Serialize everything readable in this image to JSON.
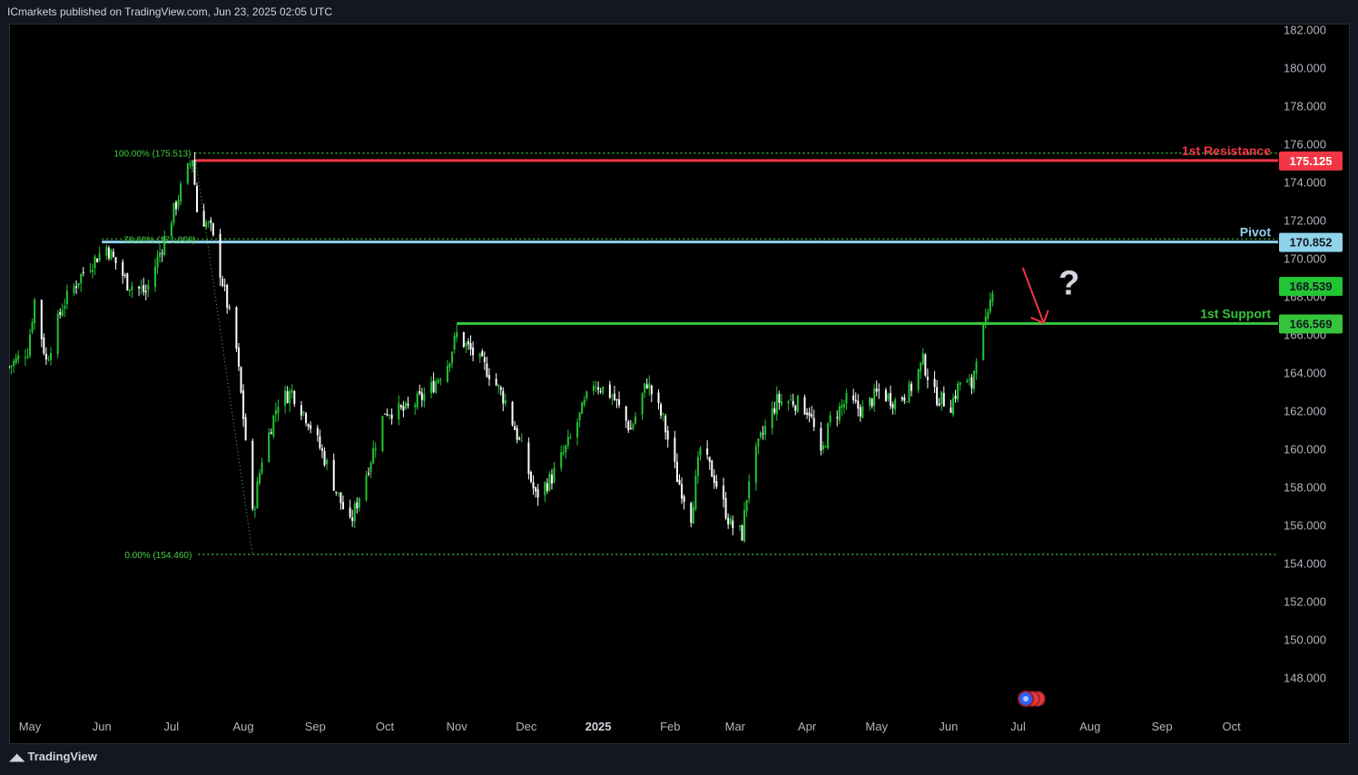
{
  "header": {
    "text": "ICmarkets published on TradingView.com, Jun 23, 2025 02:05 UTC"
  },
  "footer": {
    "brand": "TradingView",
    "logo_icon": "tradingview-logo-icon"
  },
  "colors": {
    "background": "#000000",
    "up": "#22c533",
    "down": "#ffffff",
    "resistance": "#f23645",
    "pivot": "#8fd3ea",
    "support": "#35c43b",
    "fib": "#44d044",
    "arrow": "#f23645"
  },
  "chart_data": {
    "type": "candlestick",
    "symbol": "",
    "y_axis": {
      "min": 146.0,
      "max": 183.0,
      "ticks": [
        "182.000",
        "180.000",
        "178.000",
        "176.000",
        "174.000",
        "172.000",
        "170.000",
        "168.000",
        "166.000",
        "164.000",
        "162.000",
        "160.000",
        "158.000",
        "156.000",
        "154.000",
        "152.000",
        "150.000",
        "148.000"
      ]
    },
    "x_axis": {
      "start_date": "2024-04-22",
      "end_date": "2025-10-16",
      "labels": [
        {
          "date": "2024-05-01",
          "text": "May"
        },
        {
          "date": "2024-06-01",
          "text": "Jun"
        },
        {
          "date": "2024-07-01",
          "text": "Jul"
        },
        {
          "date": "2024-08-01",
          "text": "Aug"
        },
        {
          "date": "2024-09-01",
          "text": "Sep"
        },
        {
          "date": "2024-10-01",
          "text": "Oct"
        },
        {
          "date": "2024-11-01",
          "text": "Nov"
        },
        {
          "date": "2024-12-01",
          "text": "Dec"
        },
        {
          "date": "2025-01-01",
          "text": "2025",
          "bold": true
        },
        {
          "date": "2025-02-01",
          "text": "Feb"
        },
        {
          "date": "2025-03-01",
          "text": "Mar"
        },
        {
          "date": "2025-04-01",
          "text": "Apr"
        },
        {
          "date": "2025-05-01",
          "text": "May"
        },
        {
          "date": "2025-06-01",
          "text": "Jun"
        },
        {
          "date": "2025-07-01",
          "text": "Jul"
        },
        {
          "date": "2025-08-01",
          "text": "Aug"
        },
        {
          "date": "2025-09-01",
          "text": "Sep"
        },
        {
          "date": "2025-10-01",
          "text": "Oct"
        }
      ]
    },
    "price_path": [
      {
        "date": "2024-04-22",
        "price": 164.3
      },
      {
        "date": "2024-04-30",
        "price": 165.2
      },
      {
        "date": "2024-05-03",
        "price": 167.8
      },
      {
        "date": "2024-05-08",
        "price": 164.6
      },
      {
        "date": "2024-05-15",
        "price": 167.5
      },
      {
        "date": "2024-05-24",
        "price": 169.3
      },
      {
        "date": "2024-06-03",
        "price": 170.6
      },
      {
        "date": "2024-06-12",
        "price": 168.7
      },
      {
        "date": "2024-06-20",
        "price": 168.2
      },
      {
        "date": "2024-06-28",
        "price": 171.0
      },
      {
        "date": "2024-07-05",
        "price": 173.6
      },
      {
        "date": "2024-07-10",
        "price": 175.3
      },
      {
        "date": "2024-07-12",
        "price": 172.5
      },
      {
        "date": "2024-07-18",
        "price": 171.5
      },
      {
        "date": "2024-07-24",
        "price": 168.2
      },
      {
        "date": "2024-07-29",
        "price": 165.2
      },
      {
        "date": "2024-08-02",
        "price": 160.5
      },
      {
        "date": "2024-08-05",
        "price": 156.5
      },
      {
        "date": "2024-08-09",
        "price": 159.5
      },
      {
        "date": "2024-08-16",
        "price": 162.5
      },
      {
        "date": "2024-08-22",
        "price": 163.0
      },
      {
        "date": "2024-08-29",
        "price": 161.5
      },
      {
        "date": "2024-09-05",
        "price": 159.5
      },
      {
        "date": "2024-09-11",
        "price": 157.5
      },
      {
        "date": "2024-09-16",
        "price": 156.0
      },
      {
        "date": "2024-09-25",
        "price": 159.5
      },
      {
        "date": "2024-10-01",
        "price": 162.0
      },
      {
        "date": "2024-10-10",
        "price": 162.0
      },
      {
        "date": "2024-10-20",
        "price": 163.0
      },
      {
        "date": "2024-10-28",
        "price": 164.5
      },
      {
        "date": "2024-11-01",
        "price": 166.0
      },
      {
        "date": "2024-11-08",
        "price": 165.0
      },
      {
        "date": "2024-11-15",
        "price": 164.0
      },
      {
        "date": "2024-11-22",
        "price": 162.5
      },
      {
        "date": "2024-11-29",
        "price": 160.0
      },
      {
        "date": "2024-12-05",
        "price": 157.5
      },
      {
        "date": "2024-12-12",
        "price": 158.5
      },
      {
        "date": "2024-12-20",
        "price": 160.5
      },
      {
        "date": "2024-12-30",
        "price": 163.5
      },
      {
        "date": "2025-01-07",
        "price": 162.8
      },
      {
        "date": "2025-01-15",
        "price": 161.0
      },
      {
        "date": "2025-01-22",
        "price": 163.5
      },
      {
        "date": "2025-01-29",
        "price": 161.5
      },
      {
        "date": "2025-02-04",
        "price": 158.5
      },
      {
        "date": "2025-02-10",
        "price": 156.5
      },
      {
        "date": "2025-02-14",
        "price": 160.0
      },
      {
        "date": "2025-02-20",
        "price": 158.5
      },
      {
        "date": "2025-02-27",
        "price": 156.0
      },
      {
        "date": "2025-03-04",
        "price": 155.5
      },
      {
        "date": "2025-03-07",
        "price": 158.5
      },
      {
        "date": "2025-03-12",
        "price": 160.5
      },
      {
        "date": "2025-03-19",
        "price": 162.5
      },
      {
        "date": "2025-03-26",
        "price": 162.5
      },
      {
        "date": "2025-04-02",
        "price": 162.0
      },
      {
        "date": "2025-04-07",
        "price": 159.5
      },
      {
        "date": "2025-04-11",
        "price": 161.5
      },
      {
        "date": "2025-04-18",
        "price": 162.5
      },
      {
        "date": "2025-04-25",
        "price": 162.0
      },
      {
        "date": "2025-05-02",
        "price": 163.0
      },
      {
        "date": "2025-05-09",
        "price": 162.5
      },
      {
        "date": "2025-05-15",
        "price": 163.0
      },
      {
        "date": "2025-05-21",
        "price": 164.6
      },
      {
        "date": "2025-05-26",
        "price": 162.8
      },
      {
        "date": "2025-06-02",
        "price": 162.3
      },
      {
        "date": "2025-06-06",
        "price": 163.5
      },
      {
        "date": "2025-06-11",
        "price": 163.3
      },
      {
        "date": "2025-06-13",
        "price": 165.0
      },
      {
        "date": "2025-06-16",
        "price": 166.2
      },
      {
        "date": "2025-06-18",
        "price": 166.8
      },
      {
        "date": "2025-06-20",
        "price": 168.539
      }
    ],
    "annotations": {
      "fib_100": {
        "label": "100.00% (175.513)",
        "price": 175.513,
        "date": "2024-07-11"
      },
      "fib_786": {
        "label": "78.60% (171.008)",
        "price": 171.008,
        "date": "2024-06-01"
      },
      "fib_0": {
        "label": "0.00% (154.460)",
        "price": 154.46,
        "date": "2024-08-05"
      },
      "resistance": {
        "label": "1st Resistance",
        "price": 175.125,
        "tag": "175.125",
        "start_date": "2024-07-11"
      },
      "pivot": {
        "label": "Pivot",
        "price": 170.852,
        "tag": "170.852",
        "start_date": "2024-06-01"
      },
      "support": {
        "label": "1st Support",
        "price": 166.569,
        "tag": "166.569",
        "start_date": "2024-11-01"
      },
      "last_price": {
        "price": 168.539,
        "tag": "168.539"
      },
      "arrow": {
        "from_date": "2025-07-03",
        "from_price": 169.5,
        "to_date": "2025-07-12",
        "to_price": 166.6
      },
      "question_mark": {
        "text": "?",
        "date": "2025-07-23",
        "price": 168.1
      }
    }
  }
}
